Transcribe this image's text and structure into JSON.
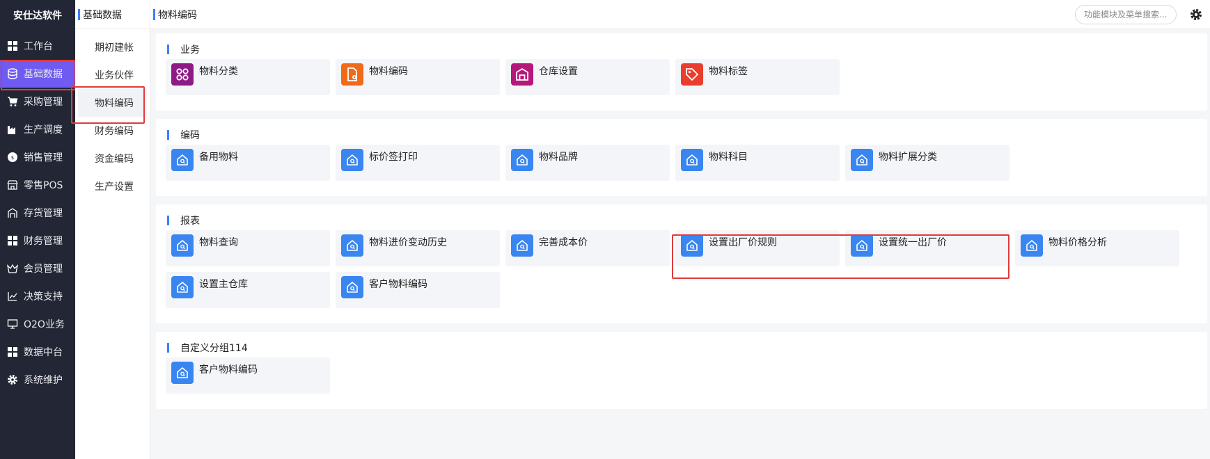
{
  "app": {
    "brand": "安仕达软件"
  },
  "nav": {
    "items": [
      {
        "label": "工作台",
        "icon": "grid-icon"
      },
      {
        "label": "基础数据",
        "icon": "database-icon",
        "active": true
      },
      {
        "label": "采购管理",
        "icon": "cart-icon"
      },
      {
        "label": "生产调度",
        "icon": "factory-icon"
      },
      {
        "label": "销售管理",
        "icon": "sales-icon"
      },
      {
        "label": "零售POS",
        "icon": "store-icon"
      },
      {
        "label": "存货管理",
        "icon": "warehouse-icon"
      },
      {
        "label": "财务管理",
        "icon": "grid-icon"
      },
      {
        "label": "会员管理",
        "icon": "crown-icon"
      },
      {
        "label": "决策支持",
        "icon": "chart-icon"
      },
      {
        "label": "O2O业务",
        "icon": "monitor-icon"
      },
      {
        "label": "数据中台",
        "icon": "grid-icon"
      },
      {
        "label": "系统维护",
        "icon": "gear-icon"
      }
    ]
  },
  "subnav": {
    "title": "基础数据",
    "items": [
      {
        "label": "期初建帐"
      },
      {
        "label": "业务伙伴"
      },
      {
        "label": "物料编码",
        "active": true
      },
      {
        "label": "财务编码"
      },
      {
        "label": "资金编码"
      },
      {
        "label": "生产设置"
      }
    ]
  },
  "topbar": {
    "breadcrumb": "物料编码",
    "search_placeholder": "功能模块及菜单搜索..."
  },
  "groups": [
    {
      "title": "业务",
      "tiles": [
        {
          "label": "物料分类",
          "color": "#8e1a86",
          "icon": "category-icon"
        },
        {
          "label": "物料编码",
          "color": "#f06a1a",
          "icon": "file-gear-icon"
        },
        {
          "label": "仓库设置",
          "color": "#b5187a",
          "icon": "warehouse-icon"
        },
        {
          "label": "物料标签",
          "color": "#ea3d2e",
          "icon": "tag-icon"
        }
      ]
    },
    {
      "title": "编码",
      "tiles": [
        {
          "label": "备用物料",
          "color": "#3a86f0",
          "icon": "house-search-icon"
        },
        {
          "label": "标价签打印",
          "color": "#3a86f0",
          "icon": "house-search-icon"
        },
        {
          "label": "物料品牌",
          "color": "#3a86f0",
          "icon": "house-search-icon"
        },
        {
          "label": "物料科目",
          "color": "#3a86f0",
          "icon": "house-search-icon"
        },
        {
          "label": "物料扩展分类",
          "color": "#3a86f0",
          "icon": "house-search-icon"
        }
      ]
    },
    {
      "title": "报表",
      "tiles": [
        {
          "label": "物料查询",
          "color": "#3a86f0",
          "icon": "house-search-icon"
        },
        {
          "label": "物料进价变动历史",
          "color": "#3a86f0",
          "icon": "house-search-icon"
        },
        {
          "label": "完善成本价",
          "color": "#3a86f0",
          "icon": "house-search-icon"
        },
        {
          "label": "设置出厂价规则",
          "color": "#3a86f0",
          "icon": "house-search-icon"
        },
        {
          "label": "设置统一出厂价",
          "color": "#3a86f0",
          "icon": "house-search-icon"
        },
        {
          "label": "物料价格分析",
          "color": "#3a86f0",
          "icon": "house-search-icon"
        },
        {
          "label": "设置主仓库",
          "color": "#3a86f0",
          "icon": "house-search-icon"
        },
        {
          "label": "客户物料编码",
          "color": "#3a86f0",
          "icon": "house-search-icon"
        }
      ]
    },
    {
      "title": "自定义分组114",
      "tiles": [
        {
          "label": "客户物料编码",
          "color": "#3a86f0",
          "icon": "house-search-icon"
        }
      ]
    }
  ]
}
